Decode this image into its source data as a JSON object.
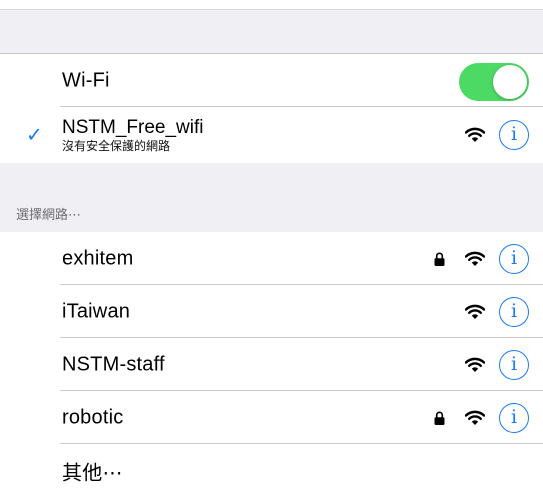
{
  "wifi_toggle": {
    "label": "Wi-Fi",
    "on": true,
    "on_color": "#4cd964"
  },
  "connected_network": {
    "name": "NSTM_Free_wifi",
    "subtitle": "沒有安全保護的網路",
    "checkmark": "✓"
  },
  "section_header": "選擇網路⋯",
  "networks": [
    {
      "name": "exhitem",
      "locked": true
    },
    {
      "name": "iTaiwan",
      "locked": false
    },
    {
      "name": "NSTM-staff",
      "locked": false
    },
    {
      "name": "robotic",
      "locked": true
    }
  ],
  "other_label": "其他⋯",
  "info_glyph": "i",
  "accent_color": "#1a7cf5",
  "icons": {
    "wifi": "wifi-icon",
    "lock": "lock-icon",
    "info": "info-icon",
    "check": "checkmark-icon"
  }
}
